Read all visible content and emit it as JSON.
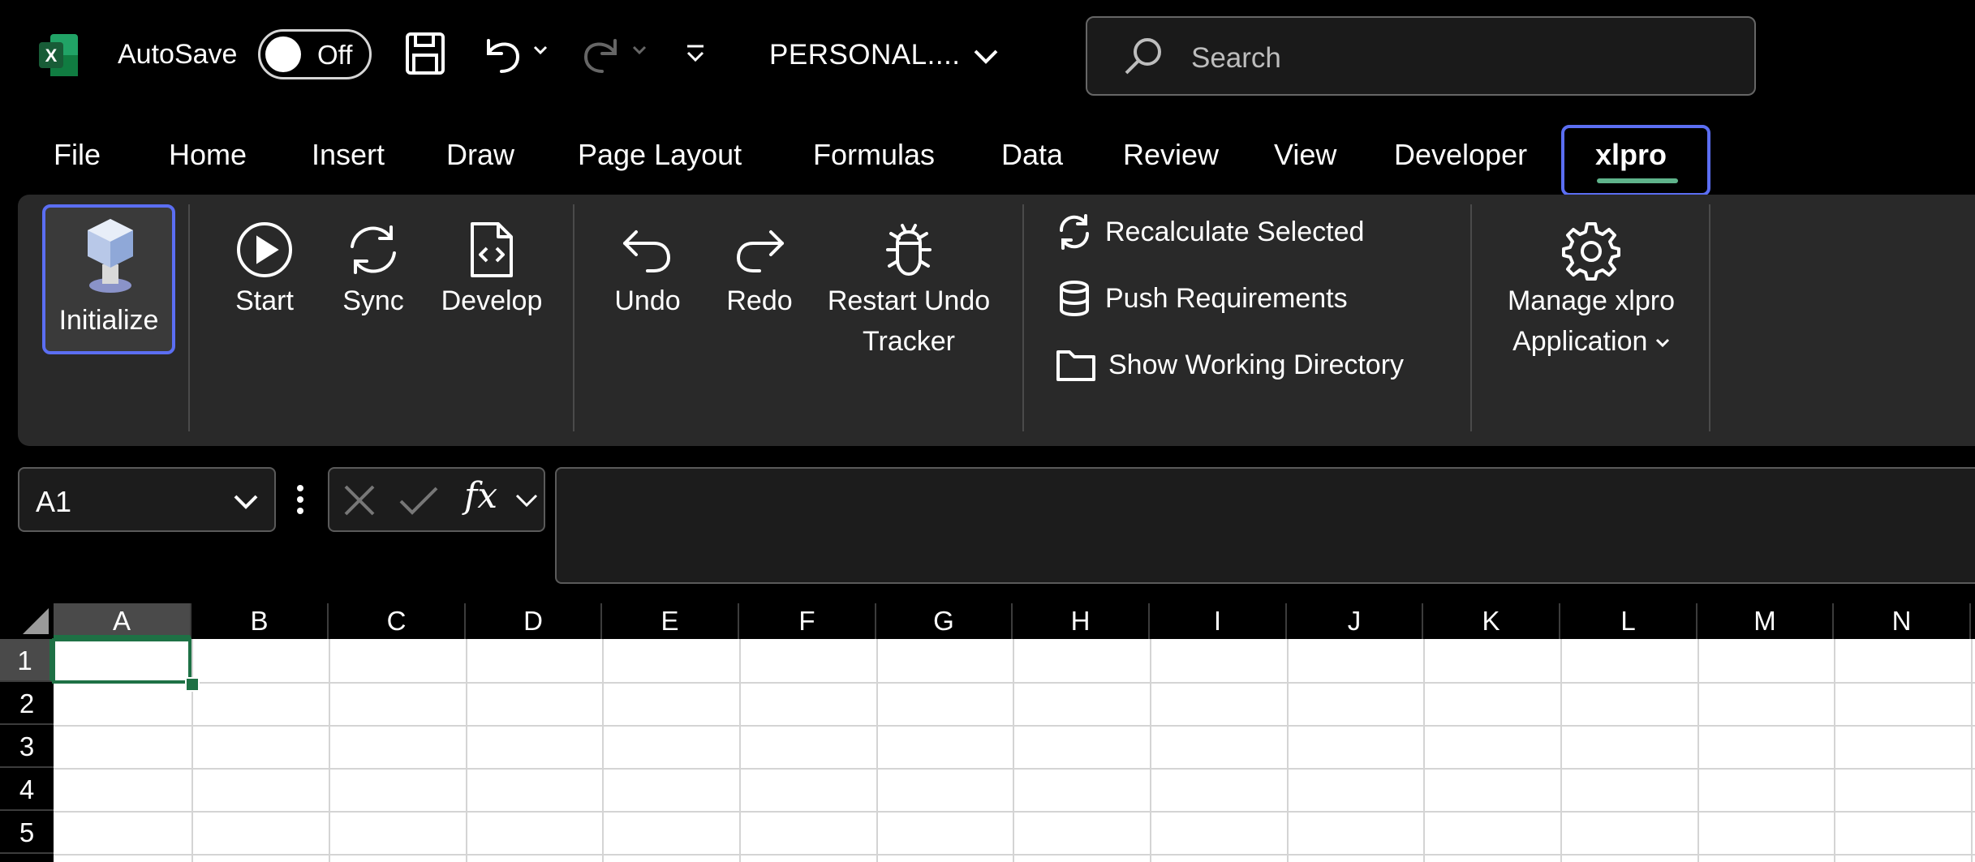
{
  "titlebar": {
    "autosave_label": "AutoSave",
    "autosave_state": "Off",
    "file_title": "PERSONAL....",
    "search_placeholder": "Search"
  },
  "tabs": [
    "File",
    "Home",
    "Insert",
    "Draw",
    "Page Layout",
    "Formulas",
    "Data",
    "Review",
    "View",
    "Developer",
    "xlpro"
  ],
  "active_tab": "xlpro",
  "ribbon": {
    "initialize": "Initialize",
    "start": "Start",
    "sync": "Sync",
    "develop": "Develop",
    "undo": "Undo",
    "redo": "Redo",
    "restart_line1": "Restart Undo",
    "restart_line2": "Tracker",
    "recalculate": "Recalculate Selected",
    "push": "Push Requirements",
    "show_dir": "Show Working Directory",
    "manage_line1": "Manage xlpro",
    "manage_line2": "Application"
  },
  "formula_bar": {
    "name_box": "A1",
    "fx_label": "fx",
    "formula": ""
  },
  "grid": {
    "columns": [
      "A",
      "B",
      "C",
      "D",
      "E",
      "F",
      "G",
      "H",
      "I",
      "J",
      "K",
      "L",
      "M",
      "N"
    ],
    "rows": [
      "1",
      "2",
      "3",
      "4",
      "5"
    ],
    "selected_cell": "A1"
  },
  "colors": {
    "accent_highlight": "#5b6ef2",
    "excel_green": "#1e7145",
    "tab_underline": "#5fb38b",
    "ribbon_bg": "#292929"
  }
}
